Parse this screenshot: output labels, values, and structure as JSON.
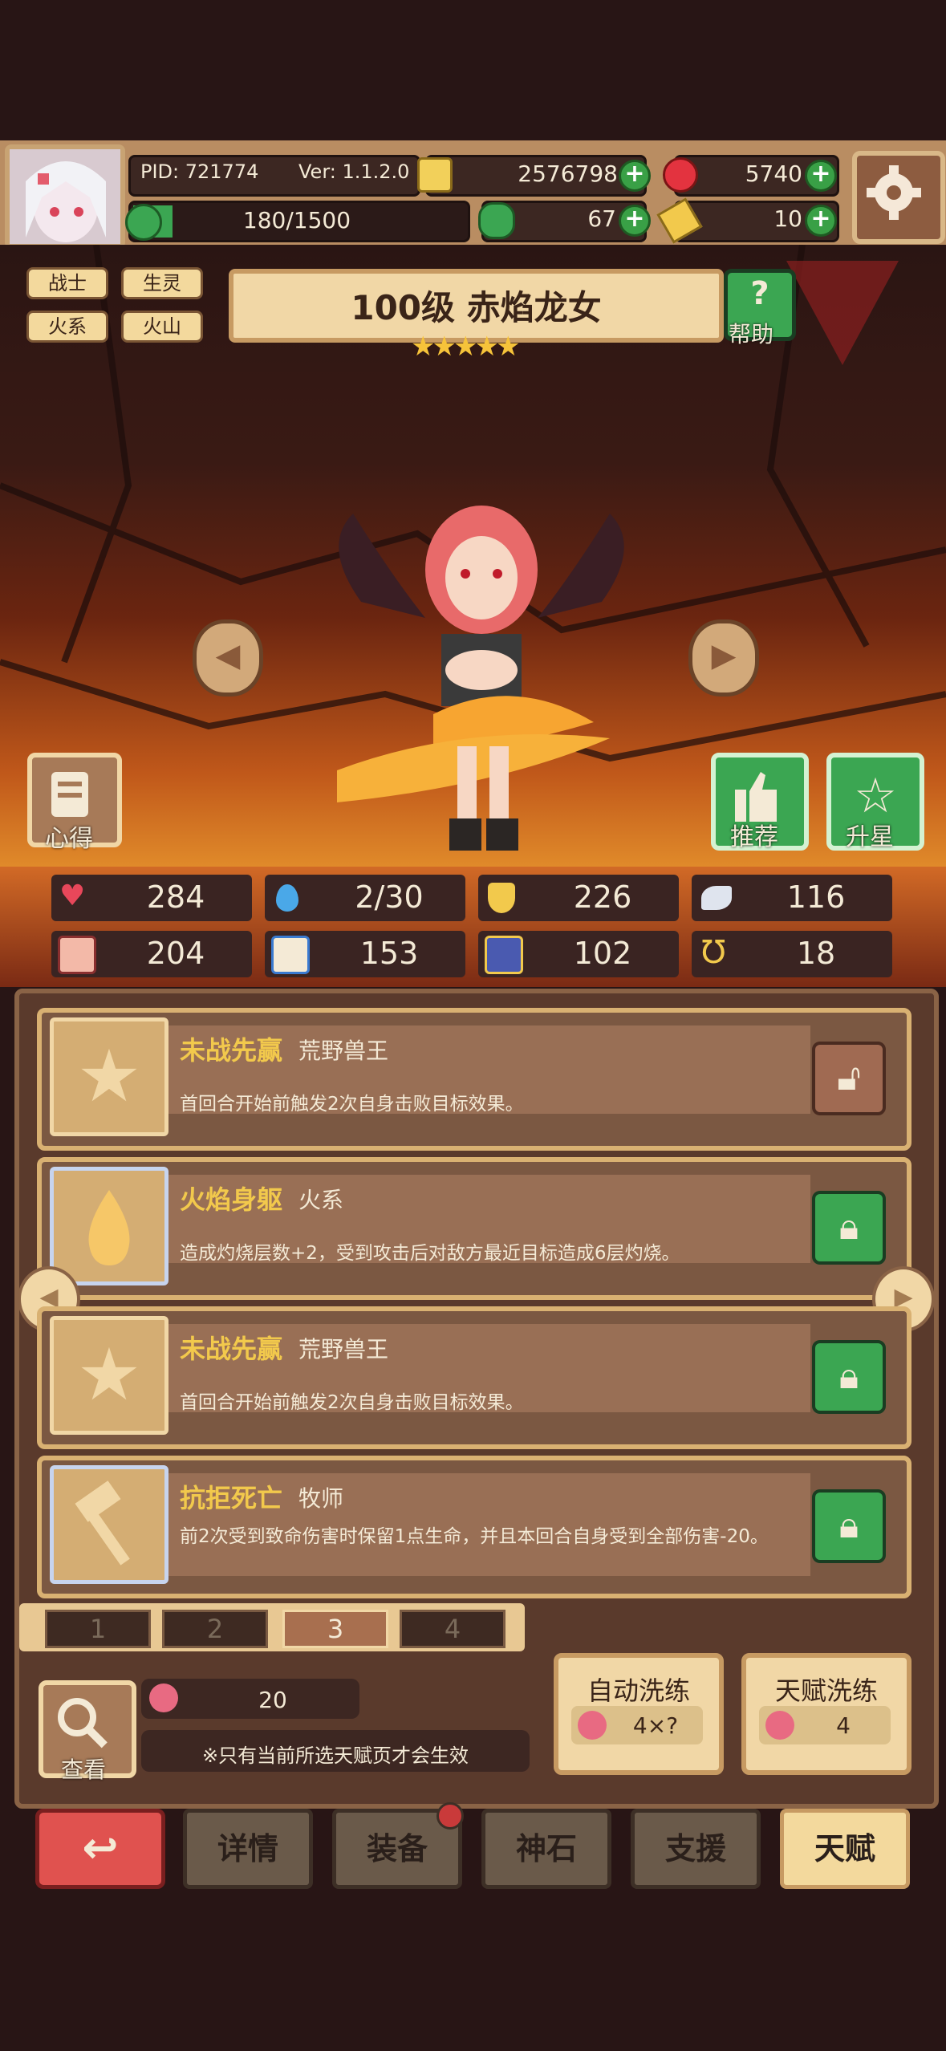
{
  "header": {
    "pid": "PID: 721774",
    "version": "Ver: 1.1.2.0",
    "gold": "2576798",
    "gems": "5740",
    "energy": "180/1500",
    "energy_fraction": 0.12,
    "clover": "67",
    "ticket": "10"
  },
  "hero": {
    "tags": [
      "战士",
      "生灵",
      "火系",
      "火山"
    ],
    "title": "100级 赤焰龙女",
    "stars": 5,
    "help_label": "帮助",
    "notes_label": "心得",
    "recommend_label": "推荐",
    "star_up_label": "升星"
  },
  "stats": [
    {
      "icon": "heart-icon",
      "value": "284"
    },
    {
      "icon": "water-drop-icon",
      "value": "2/30"
    },
    {
      "icon": "shield-icon",
      "value": "226"
    },
    {
      "icon": "feather-icon",
      "value": "116"
    },
    {
      "icon": "fist-icon",
      "value": "204"
    },
    {
      "icon": "book-icon",
      "value": "153"
    },
    {
      "icon": "boots-icon",
      "value": "102"
    },
    {
      "icon": "horseshoe-icon",
      "value": "18"
    }
  ],
  "talents": [
    {
      "name": "未战先赢",
      "type": "荒野兽王",
      "desc": "首回合开始前触发2次自身击败目标效果。",
      "icon": "star-icon",
      "locked": false
    },
    {
      "name": "火焰身躯",
      "type": "火系",
      "desc": "造成灼烧层数+2，受到攻击后对敌方最近目标造成6层灼烧。",
      "icon": "flame-icon",
      "locked": true
    },
    {
      "name": "未战先赢",
      "type": "荒野兽王",
      "desc": "首回合开始前触发2次自身击败目标效果。",
      "icon": "star-icon",
      "locked": true
    },
    {
      "name": "抗拒死亡",
      "type": "牧师",
      "desc": "前2次受到致命伤害时保留1点生命，并且本回合自身受到全部伤害-20。",
      "icon": "hammer-icon",
      "locked": true
    }
  ],
  "pages": [
    "1",
    "2",
    "3",
    "4"
  ],
  "active_page": "3",
  "bottom_panel": {
    "fruit_count": "20",
    "note": "※只有当前所选天赋页才会生效",
    "view_label": "查看",
    "auto_reset_label": "自动洗练",
    "auto_reset_cost": "4×?",
    "talent_reset_label": "天赋洗练",
    "talent_reset_cost": "4"
  },
  "nav": {
    "back": "back-arrow-icon",
    "items": [
      "详情",
      "装备",
      "神石",
      "支援",
      "天赋"
    ],
    "active": "天赋"
  },
  "colors": {
    "lock_green": "#3ba652",
    "gold_text": "#f2c94c",
    "panel_brown": "#7b5842",
    "active_nav": "#f3d99d",
    "back_red": "#e0524f"
  }
}
